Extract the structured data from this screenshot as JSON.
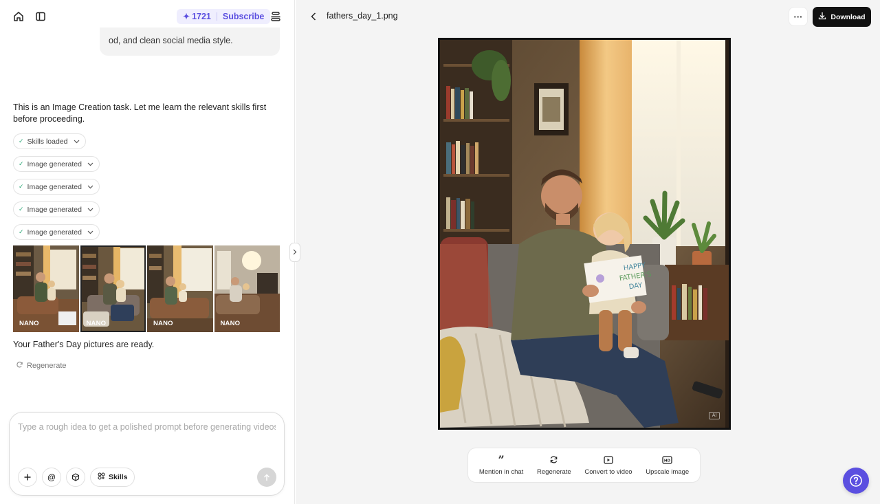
{
  "header": {
    "credits": "1721",
    "subscribe_label": "Subscribe",
    "icons": {
      "home": "home-icon",
      "sidebar": "sidebar-toggle-icon",
      "star": "sparkle-icon",
      "menu": "stack-icon"
    }
  },
  "chat": {
    "user_message_tail": "od, and clean social media style.",
    "assistant_intro": "This is an Image Creation task. Let me learn the relevant skills first before proceeding.",
    "steps": [
      {
        "label": "Skills loaded"
      },
      {
        "label": "Image generated"
      },
      {
        "label": "Image generated"
      },
      {
        "label": "Image generated"
      },
      {
        "label": "Image generated"
      }
    ],
    "thumbnails": [
      {
        "badge": "NANO",
        "selected": false
      },
      {
        "badge": "NANO",
        "selected": true
      },
      {
        "badge": "NANO",
        "selected": false
      },
      {
        "badge": "NANO",
        "selected": false
      }
    ],
    "ready_text": "Your Father's Day pictures are ready.",
    "regenerate_label": "Regenerate"
  },
  "composer": {
    "placeholder": "Type a rough idea to get a polished prompt before generating videos or",
    "value": "",
    "skills_label": "Skills",
    "icons": [
      "plus-icon",
      "at-icon",
      "cube-icon",
      "skills-grid-icon",
      "send-arrow-icon"
    ]
  },
  "preview": {
    "file_name": "fathers_day_1.png",
    "download_label": "Download",
    "more_label": "···",
    "card_text": [
      "HAPPY",
      "FATHER'S",
      "DAY"
    ],
    "ai_watermark": "AI",
    "actions": [
      {
        "label": "Mention in chat",
        "icon": "quote-icon"
      },
      {
        "label": "Regenerate",
        "icon": "refresh-icon"
      },
      {
        "label": "Convert to video",
        "icon": "video-icon"
      },
      {
        "label": "Upscale image",
        "icon": "hd-icon"
      }
    ]
  },
  "colors": {
    "accent": "#5b4fe0",
    "accent_bg": "#efeefe",
    "check": "#2aa876",
    "download_bg": "#111111"
  }
}
